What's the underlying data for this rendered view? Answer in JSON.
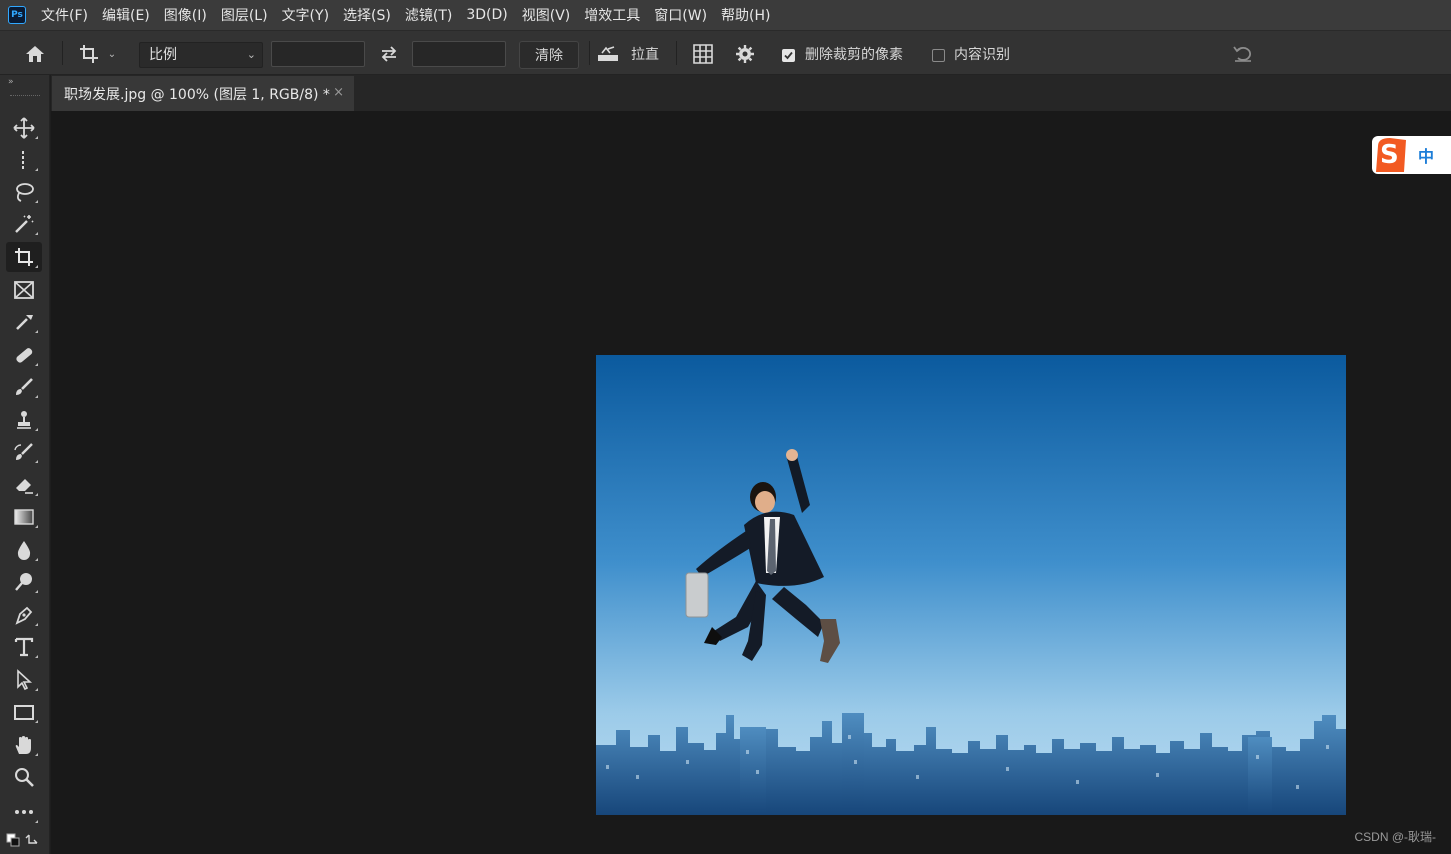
{
  "app": {
    "logo_text": "Ps"
  },
  "menu": [
    "文件(F)",
    "编辑(E)",
    "图像(I)",
    "图层(L)",
    "文字(Y)",
    "选择(S)",
    "滤镜(T)",
    "3D(D)",
    "视图(V)",
    "增效工具",
    "窗口(W)",
    "帮助(H)"
  ],
  "options": {
    "ratio_select": "比例",
    "width_value": "",
    "height_value": "",
    "clear_label": "清除",
    "straighten_label": "拉直",
    "delete_cropped_label": "删除裁剪的像素",
    "delete_cropped_checked": true,
    "content_aware_label": "内容识别",
    "content_aware_checked": false
  },
  "tools": [
    "move-tool",
    "marquee-tool",
    "lasso-tool",
    "magic-wand-tool",
    "crop-tool",
    "frame-tool",
    "eyedropper-tool",
    "healing-brush-tool",
    "brush-tool",
    "clone-stamp-tool",
    "history-brush-tool",
    "eraser-tool",
    "gradient-tool",
    "blur-tool",
    "dodge-tool",
    "pen-tool",
    "type-tool",
    "path-selection-tool",
    "rectangle-tool",
    "hand-tool",
    "zoom-tool",
    "more-tools"
  ],
  "active_tool": "crop-tool",
  "document": {
    "tab_title": "职场发展.jpg @ 100% (图层 1, RGB/8) *",
    "close_glyph": "×"
  },
  "ime": {
    "label": "中",
    "brand_letter": "S"
  },
  "watermark": "CSDN @-耿瑞-",
  "colors": {
    "ui_bg": "#333333",
    "canvas_bg": "#191919",
    "accent": "#31a8ff",
    "sky_top": "#0d5ea3",
    "sky_bottom": "#b9d9ef"
  }
}
